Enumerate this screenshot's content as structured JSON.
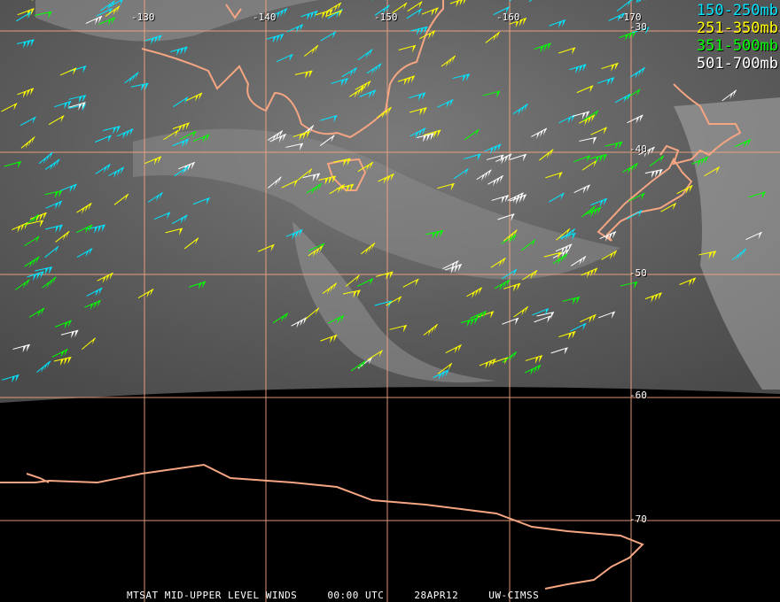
{
  "map": {
    "lon_labels": [
      "-130",
      "-140",
      "-150",
      "-160",
      "-170"
    ],
    "lat_labels": [
      "-30",
      "-40",
      "-50",
      "-60",
      "-70"
    ],
    "graticule_color": "#f4a582",
    "coastline_color": "#f4a582",
    "background_space": "#000000"
  },
  "legend": [
    {
      "label": "150-250mb",
      "color": "#00e5ff"
    },
    {
      "label": "251-350mb",
      "color": "#ffff00"
    },
    {
      "label": "351-500mb",
      "color": "#00ff00"
    },
    {
      "label": "501-700mb",
      "color": "#ffffff"
    }
  ],
  "footer": {
    "product": "MTSAT MID-UPPER LEVEL WINDS",
    "time": "00:00 UTC",
    "date": "28APR12",
    "source": "UW-CIMSS"
  }
}
